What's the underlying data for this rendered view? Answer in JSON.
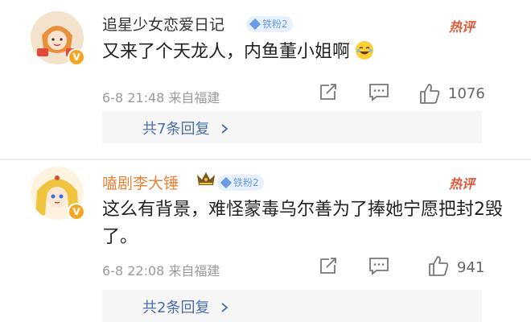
{
  "comments": [
    {
      "username": "追星少女恋爱日记",
      "fan_badge": "铁粉2",
      "hot_label": "热评",
      "text": "又来了个天龙人，内鱼董小姐啊",
      "emoji": "laughing-tears",
      "date": "6-8 21:48",
      "location": "来自福建",
      "likes": "1076",
      "replies_label": "共7条回复"
    },
    {
      "username": "嗑剧李大锤",
      "fan_badge": "铁粉2",
      "hot_label": "热评",
      "text": "这么有背景，难怪蒙毒乌尔善为了捧她宁愿把封2毁了。",
      "date": "6-8 22:08",
      "location": "来自福建",
      "likes": "941",
      "replies_label": "共2条回复"
    }
  ],
  "colors": {
    "username_vip": "#e8833a",
    "fan_badge": "#6a9be6",
    "hot": "#e05a3a",
    "link": "#4a6ea8",
    "meta": "#9a9a9a"
  }
}
